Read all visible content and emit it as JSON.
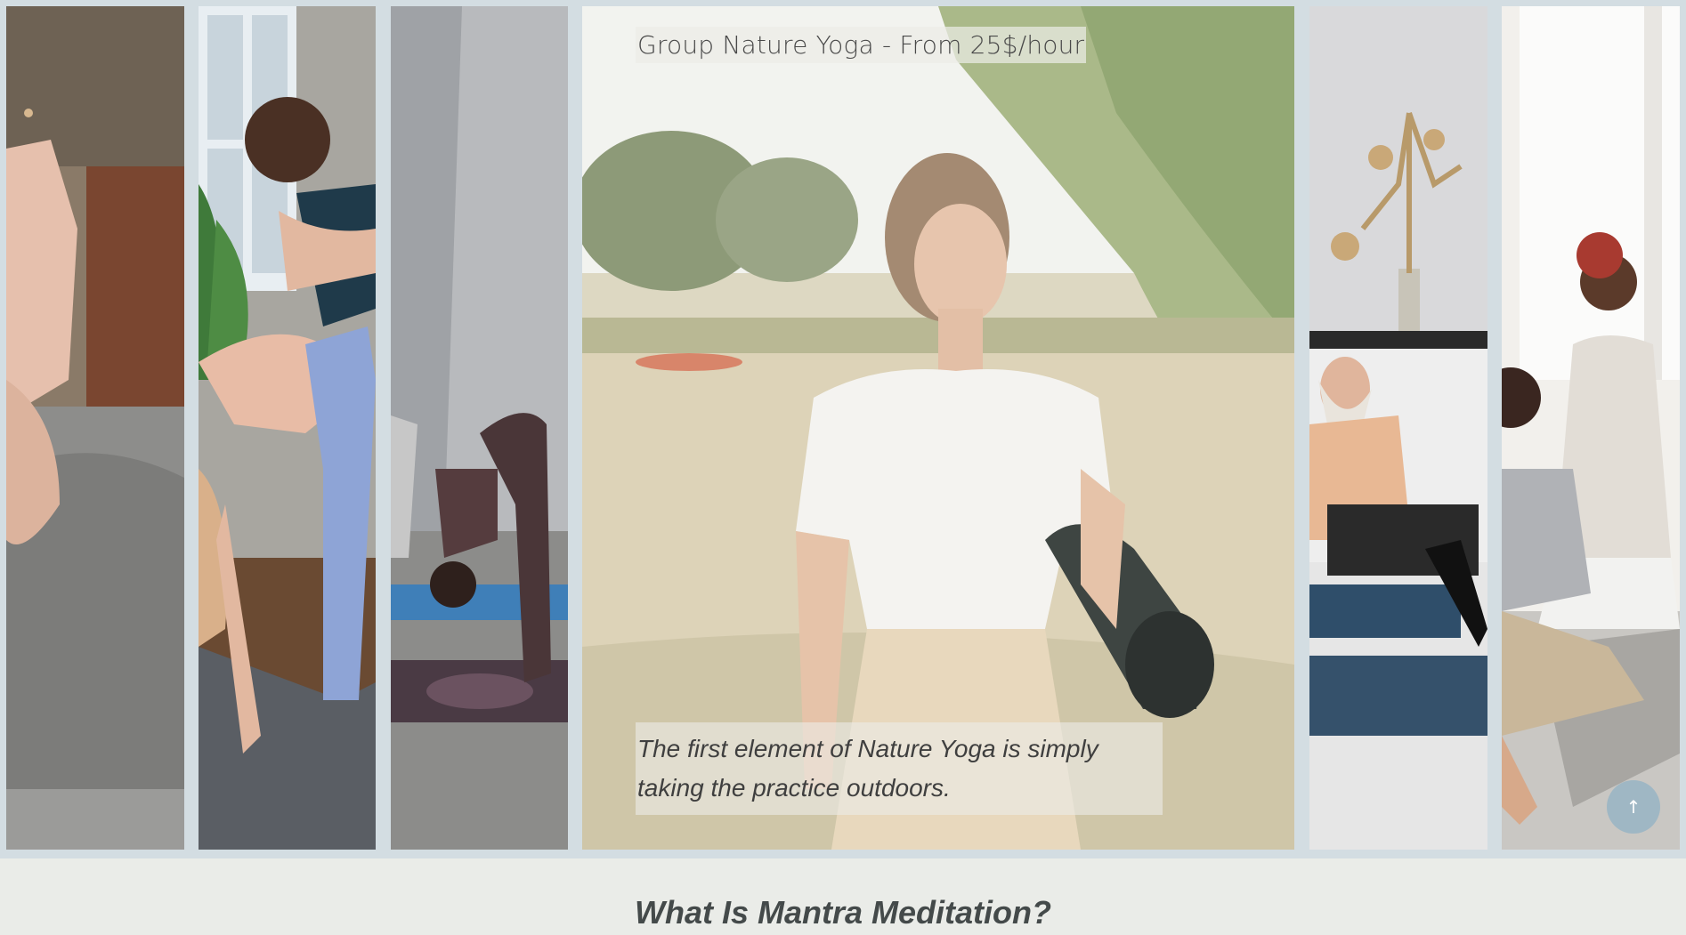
{
  "gallery": {
    "featured_title": "Group Nature Yoga - From 25$/hour",
    "featured_description": "The first element of Nature Yoga is simply taking the practice outdoors."
  },
  "scroll_top": {
    "icon": "arrow-up-icon",
    "glyph": "↑"
  },
  "section": {
    "heading": "What Is Mantra Meditation?"
  },
  "colors": {
    "page_background": "#eaece8",
    "gallery_frame": "#d3dde2",
    "scroll_button": "#9db6c4"
  }
}
